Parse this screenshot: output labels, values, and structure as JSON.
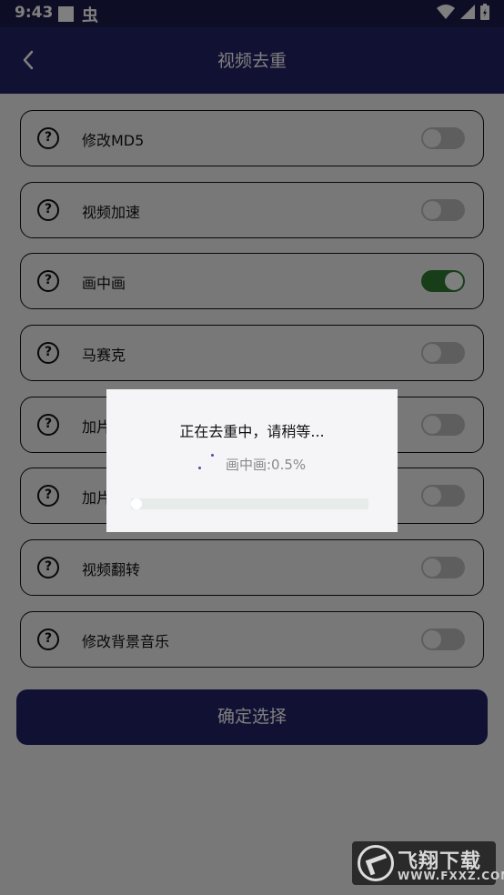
{
  "statusbar": {
    "time": "9:43",
    "bug_glyph": "虫"
  },
  "toolbar": {
    "title": "视频去重"
  },
  "options": [
    {
      "label": "修改MD5",
      "enabled": false
    },
    {
      "label": "视频加速",
      "enabled": false
    },
    {
      "label": "画中画",
      "enabled": true
    },
    {
      "label": "马赛克",
      "enabled": false
    },
    {
      "label": "加片",
      "enabled": false
    },
    {
      "label": "加片",
      "enabled": false
    },
    {
      "label": "视频翻转",
      "enabled": false
    },
    {
      "label": "修改背景音乐",
      "enabled": false
    }
  ],
  "help_glyph": "?",
  "confirm_label": "确定选择",
  "dialog": {
    "title": "正在去重中，请稍等...",
    "progress_text": "画中画:0.5%",
    "progress_value": 0.005
  },
  "watermark": {
    "text": "飞翔下载",
    "url": "WWW.FXXZ.COM"
  },
  "icons": {
    "back": "chevron-left-icon",
    "help": "question-circle-icon",
    "wifi": "wifi-icon",
    "signal": "signal-icon",
    "battery": "battery-icon"
  },
  "colors": {
    "toolbar": "#222268",
    "toggle_on": "#2e7d32",
    "scrim": "rgba(0,0,0,0.5)"
  }
}
